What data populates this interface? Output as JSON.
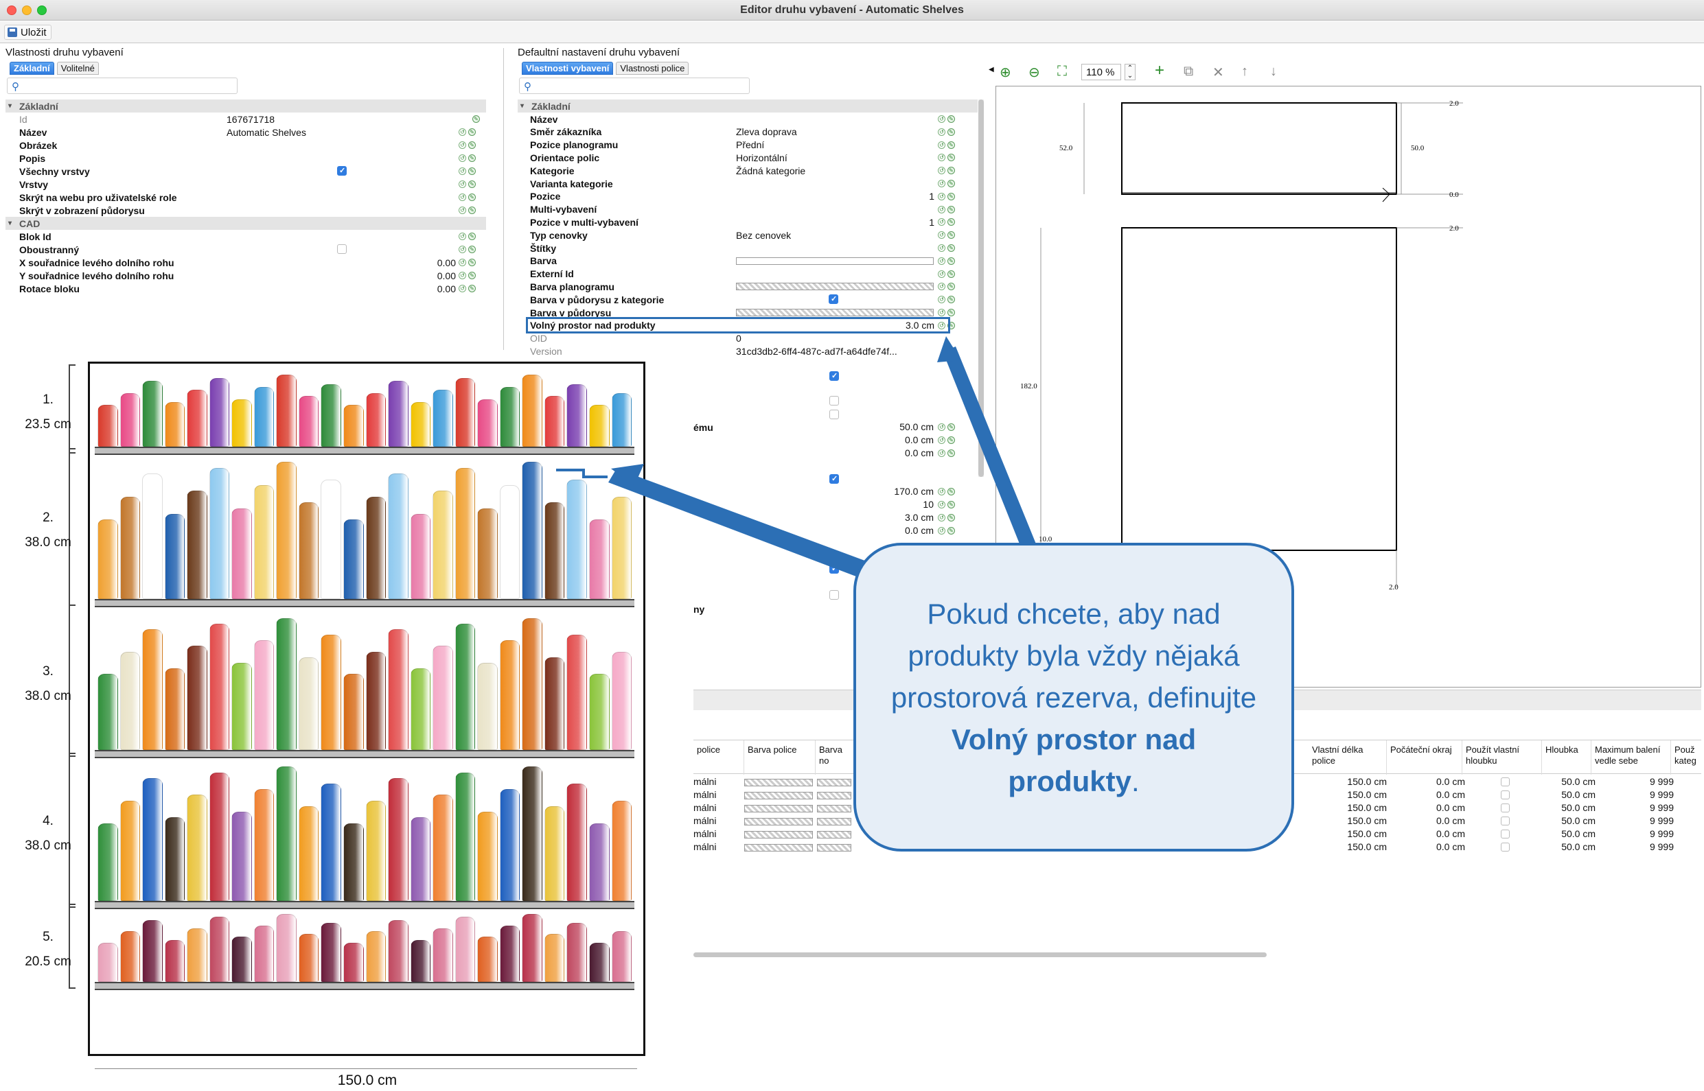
{
  "window": {
    "title": "Editor druhu vybavení - Automatic Shelves"
  },
  "toolbar": {
    "save_label": "Uložit"
  },
  "left_panel": {
    "title": "Vlastnosti druhu vybavení",
    "tabs": [
      "Základní",
      "Volitelné"
    ],
    "groups": {
      "basic": "Základní",
      "cad": "CAD"
    },
    "rows": [
      {
        "name": "Id",
        "value": "167671718"
      },
      {
        "name": "Název",
        "value": "Automatic Shelves"
      },
      {
        "name": "Obrázek",
        "value": ""
      },
      {
        "name": "Popis",
        "value": ""
      },
      {
        "name": "Všechny vrstvy",
        "value": ""
      },
      {
        "name": "Vrstvy",
        "value": ""
      },
      {
        "name": "Skrýt na webu pro uživatelské role",
        "value": ""
      },
      {
        "name": "Skrýt v zobrazení půdorysu",
        "value": ""
      }
    ],
    "cad_rows": [
      {
        "name": "Blok Id",
        "value": ""
      },
      {
        "name": "Oboustranný",
        "value": ""
      },
      {
        "name": "X souřadnice levého dolního rohu",
        "value": "0.00"
      },
      {
        "name": "Y souřadnice levého dolního rohu",
        "value": "0.00"
      },
      {
        "name": "Rotace bloku",
        "value": "0.00"
      }
    ]
  },
  "right_panel": {
    "title": "Defaultní nastavení druhu vybavení",
    "tabs": [
      "Vlastnosti vybavení",
      "Vlastnosti police"
    ],
    "group": "Základní",
    "rows": [
      {
        "name": "Název",
        "value": ""
      },
      {
        "name": "Směr zákazníka",
        "value": "Zleva doprava"
      },
      {
        "name": "Pozice planogramu",
        "value": "Přední"
      },
      {
        "name": "Orientace polic",
        "value": "Horizontální"
      },
      {
        "name": "Kategorie",
        "value": "Žádná kategorie"
      },
      {
        "name": "Varianta kategorie",
        "value": ""
      },
      {
        "name": "Pozice",
        "value": "1"
      },
      {
        "name": "Multi-vybavení",
        "value": ""
      },
      {
        "name": "Pozice v multi-vybavení",
        "value": "1"
      },
      {
        "name": "Typ cenovky",
        "value": "Bez cenovek"
      },
      {
        "name": "Štítky",
        "value": ""
      },
      {
        "name": "Barva",
        "value": ""
      },
      {
        "name": "Externí Id",
        "value": ""
      },
      {
        "name": "Barva planogramu",
        "value": ""
      },
      {
        "name": "Barva v půdorysu z kategorie",
        "value": ""
      },
      {
        "name": "Barva v půdorysu",
        "value": ""
      },
      {
        "name": "Volný prostor nad produkty",
        "value": "3.0 cm"
      },
      {
        "name": "OID",
        "value": "0"
      },
      {
        "name": "Version",
        "value": "31cd3db2-6ff4-487c-ad7f-a64dfe74f..."
      }
    ],
    "extra_values": [
      "50.0 cm",
      "0.0 cm",
      "0.0 cm",
      "170.0 cm",
      "10",
      "3.0 cm",
      "0.0 cm"
    ],
    "cut_labels": [
      "ému",
      "ny"
    ]
  },
  "drawing": {
    "zoom": "110 %",
    "dims": {
      "top_right": "2.0",
      "left": "52.0",
      "right": "50.0",
      "zero": "0.0",
      "mid_right": "2.0",
      "height": "182.0",
      "bottom_left": "10.0",
      "bottom": "2.0"
    }
  },
  "bottom_table": {
    "headers_left": [
      "police",
      "Barva police",
      "Barva no"
    ],
    "headers_right": [
      "Vlastní délka police",
      "Počáteční okraj",
      "Použít vlastní hloubku",
      "Hloubka",
      "Maximum balení vedle sebe",
      "Použ kateg"
    ],
    "rows": [
      {
        "type": "málni",
        "length": "150.0 cm",
        "margin": "0.0 cm",
        "depth": "50.0 cm",
        "max": "9 999"
      },
      {
        "type": "málni",
        "length": "150.0 cm",
        "margin": "0.0 cm",
        "depth": "50.0 cm",
        "max": "9 999"
      },
      {
        "type": "málni",
        "length": "150.0 cm",
        "margin": "0.0 cm",
        "depth": "50.0 cm",
        "max": "9 999"
      },
      {
        "type": "málni",
        "length": "150.0 cm",
        "margin": "0.0 cm",
        "depth": "50.0 cm",
        "max": "9 999"
      },
      {
        "type": "málni",
        "length": "150.0 cm",
        "margin": "0.0 cm",
        "depth": "50.0 cm",
        "max": "9 999"
      },
      {
        "type": "málni",
        "length": "150.0 cm",
        "margin": "0.0 cm",
        "depth": "50.0 cm",
        "max": "9 999"
      }
    ]
  },
  "shelf_image": {
    "shelves": [
      {
        "num": "1.",
        "height": "23.5 cm"
      },
      {
        "num": "2.",
        "height": "38.0 cm"
      },
      {
        "num": "3.",
        "height": "38.0 cm"
      },
      {
        "num": "4.",
        "height": "38.0 cm"
      },
      {
        "num": "5.",
        "height": "20.5 cm"
      }
    ],
    "width_label": "150.0 cm"
  },
  "callout": {
    "text_before": "Pokud chcete, aby nad produkty byla vždy nějaká prostorová rezerva, definujte ",
    "text_bold": "Volný prostor nad produkty",
    "text_after": "."
  },
  "colors": {
    "accent": "#2c6fb5",
    "tab_active": "#2f7ce0"
  }
}
